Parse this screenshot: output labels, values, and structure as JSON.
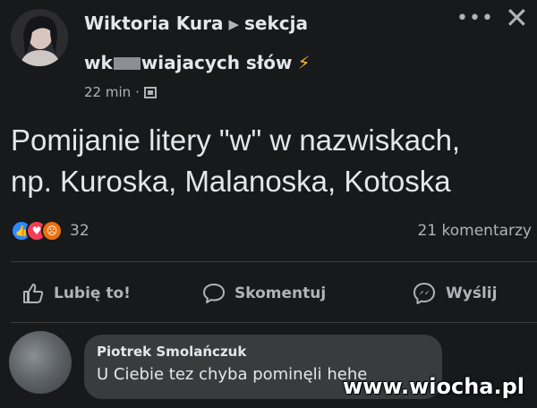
{
  "post": {
    "author": "Wiktoria Kura",
    "group_part1": "sekcja",
    "group_part2_a": "wk",
    "group_part2_b": "wiajacych słów",
    "time": "22 min",
    "dot": "·",
    "text_line1": "Pomijanie litery \"w\" w nazwiskach,",
    "text_line2": "np. Kuroska, Malanoska, Kotoska",
    "reaction_count": "32",
    "comments_count": "21 komentarzy"
  },
  "actions": {
    "like": "Lubię to!",
    "comment": "Skomentuj",
    "share": "Wyślij"
  },
  "comment": {
    "author": "Piotrek Smolańczuk",
    "text": "U Ciebie tez chyba pominęli hehe"
  },
  "watermark": "www.wiocha.pl",
  "colors": {
    "background": "#18191a",
    "text": "#e4e6eb",
    "secondary": "#b0b3b8",
    "like_blue": "#2e89ff",
    "love_red": "#f33e58",
    "angry_orange": "#e9710f"
  },
  "icons": {
    "more": "more-horizontal-icon",
    "close": "close-icon",
    "privacy": "group-privacy-icon",
    "like": "thumbs-up-icon",
    "comment": "comment-bubble-icon",
    "share": "messenger-icon"
  }
}
